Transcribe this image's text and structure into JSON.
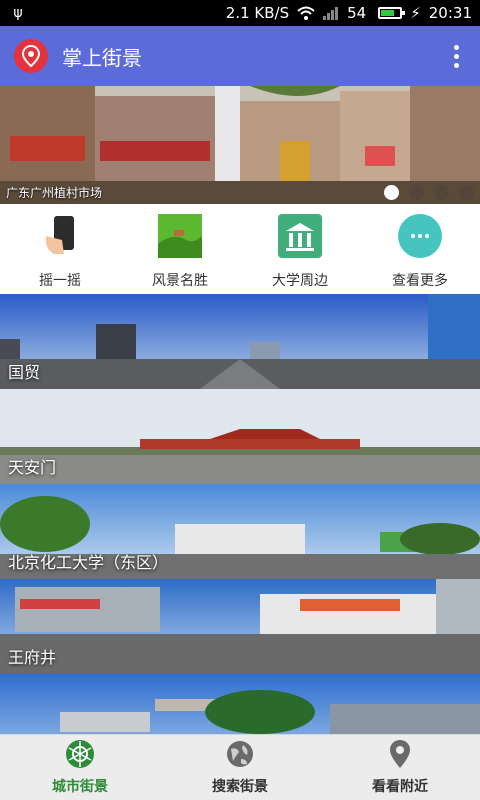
{
  "status_bar": {
    "net_speed": "2.1 KB/S",
    "signal_text": "54",
    "time": "20:31",
    "icons": [
      "usb-icon",
      "wifi-icon",
      "signal-icon",
      "battery-icon"
    ]
  },
  "app_bar": {
    "title": "掌上街景",
    "logo_icon": "location-pin-icon",
    "menu_icon": "more-vert-icon"
  },
  "banner": {
    "caption": "广东广州植村市场",
    "page_count": 4,
    "active_page": 0
  },
  "quick_actions": [
    {
      "label": "摇一摇",
      "icon": "phone-hand-icon"
    },
    {
      "label": "风景名胜",
      "icon": "scenery-icon"
    },
    {
      "label": "大学周边",
      "icon": "university-icon"
    },
    {
      "label": "查看更多",
      "icon": "more-dots-icon"
    }
  ],
  "scenes": [
    {
      "label": "国贸"
    },
    {
      "label": "天安门"
    },
    {
      "label": "北京化工大学（东区）"
    },
    {
      "label": "王府井"
    },
    {
      "label": ""
    }
  ],
  "bottom_nav": [
    {
      "label": "城市街景",
      "icon": "aperture-icon",
      "active": true
    },
    {
      "label": "搜索街景",
      "icon": "globe-icon",
      "active": false
    },
    {
      "label": "看看附近",
      "icon": "map-pin-icon",
      "active": false
    }
  ],
  "colors": {
    "app_bar": "#5b6bd9",
    "logo": "#e5323c",
    "active_nav": "#2e8b3a",
    "uni_icon": "#3fae7a",
    "more_icon": "#45c4c0"
  }
}
